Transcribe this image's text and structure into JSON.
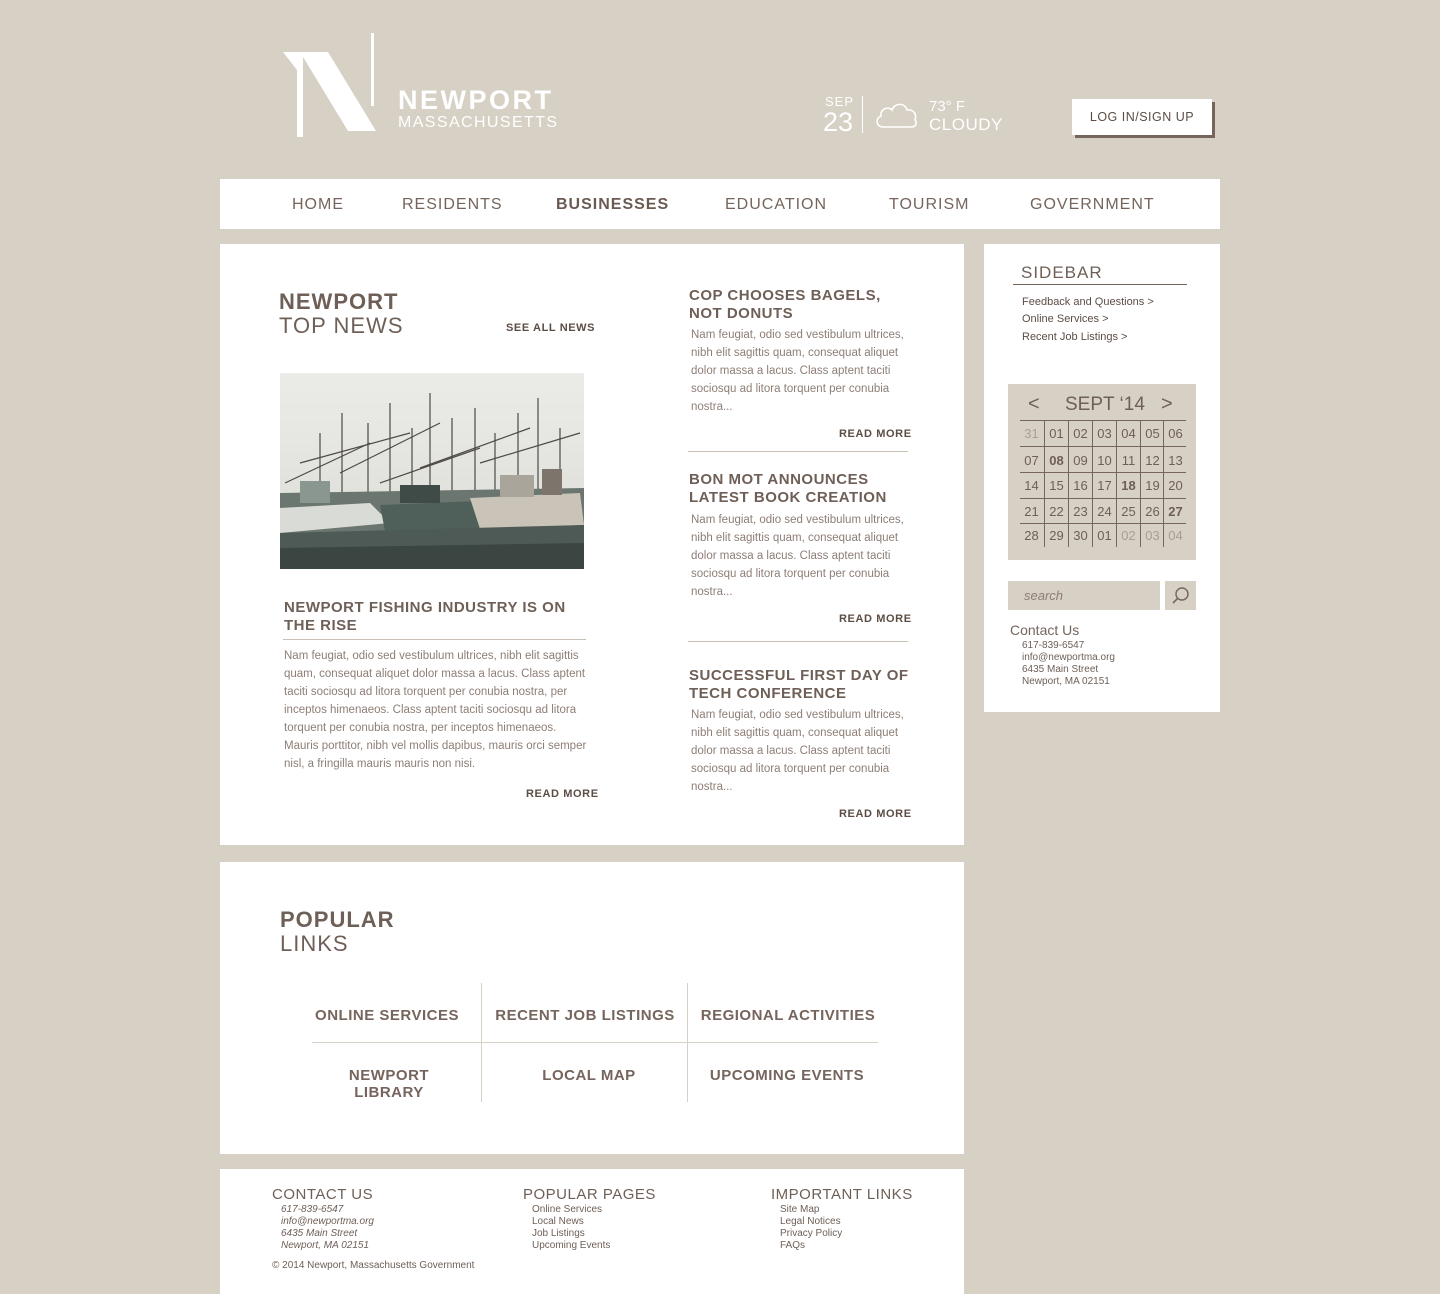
{
  "header": {
    "brand_name": "NEWPORT",
    "brand_sub": "MASSACHUSETTS",
    "weather": {
      "month": "SEP",
      "day": "23",
      "temp": "73° F",
      "condition": "CLOUDY",
      "icon": "cloud-icon"
    },
    "login_label": "LOG IN/SIGN UP"
  },
  "nav": {
    "items": [
      {
        "label": "HOME"
      },
      {
        "label": "RESIDENTS"
      },
      {
        "label": "BUSINESSES"
      },
      {
        "label": "EDUCATION"
      },
      {
        "label": "TOURISM"
      },
      {
        "label": "GOVERNMENT"
      }
    ],
    "active": "BUSINESSES"
  },
  "news": {
    "title_bold": "NEWPORT",
    "title_light": "TOP NEWS",
    "see_all": "SEE ALL NEWS",
    "featured": {
      "headline_line1": "NEWPORT FISHING INDUSTRY IS ON",
      "headline_line2": "THE RISE",
      "body_lines": [
        "Nam feugiat, odio sed vestibulum ultrices, nibh elit sagittis",
        "quam, consequat aliquet dolor massa a lacus. Class aptent",
        "taciti sociosqu ad litora torquent per conubia nostra, per",
        "inceptos himenaeos. Class aptent taciti sociosqu ad litora",
        "torquent per conubia nostra, per inceptos himenaeos.",
        "Mauris porttitor, nibh vel mollis dapibus, mauris orci semper",
        "nisl, a fringilla mauris mauris non nisi."
      ],
      "read_more": "READ MORE"
    },
    "stories": [
      {
        "headline_line1": "COP CHOOSES BAGELS,",
        "headline_line2": "NOT DONUTS",
        "body_lines": [
          "Nam feugiat, odio sed vestibulum ultrices,",
          "nibh elit sagittis quam, consequat aliquet",
          "dolor massa a lacus. Class aptent taciti",
          "sociosqu ad litora torquent per conubia",
          "nostra..."
        ],
        "read_more": "READ MORE"
      },
      {
        "headline_line1": "BON MOT ANNOUNCES",
        "headline_line2": "LATEST BOOK CREATION",
        "body_lines": [
          "Nam feugiat, odio sed vestibulum ultrices,",
          "nibh elit sagittis quam, consequat aliquet",
          "dolor massa a lacus. Class aptent taciti",
          "sociosqu ad litora torquent per conubia",
          "nostra..."
        ],
        "read_more": "READ MORE"
      },
      {
        "headline_line1": "SUCCESSFUL FIRST DAY OF",
        "headline_line2": "TECH CONFERENCE",
        "body_lines": [
          "Nam feugiat, odio sed vestibulum ultrices,",
          "nibh elit sagittis quam, consequat aliquet",
          "dolor massa a lacus. Class aptent taciti",
          "sociosqu ad litora torquent per conubia",
          "nostra..."
        ],
        "read_more": "READ MORE"
      }
    ]
  },
  "sidebar": {
    "title": "SIDEBAR",
    "links": [
      "Feedback and Questions >",
      "Online Services >",
      "Recent Job Listings >"
    ],
    "calendar": {
      "month_label": "SEPT ‘14",
      "prev": "<",
      "next": ">",
      "weeks": [
        [
          "31",
          "01",
          "02",
          "03",
          "04",
          "05",
          "06"
        ],
        [
          "07",
          "08",
          "09",
          "10",
          "11",
          "12",
          "13"
        ],
        [
          "14",
          "15",
          "16",
          "17",
          "18",
          "19",
          "20"
        ],
        [
          "21",
          "22",
          "23",
          "24",
          "25",
          "26",
          "27"
        ],
        [
          "28",
          "29",
          "30",
          "01",
          "02",
          "03",
          "04"
        ]
      ],
      "outside_month": [
        "0-0",
        "4-4",
        "4-5",
        "4-6"
      ],
      "highlighted": [
        "08",
        "18",
        "27"
      ]
    },
    "search_placeholder": "search",
    "contact": {
      "title": "Contact Us",
      "phone": "617-839-6547",
      "email": "info@newportma.org",
      "address1": "6435 Main Street",
      "address2": "Newport, MA 02151"
    }
  },
  "popular": {
    "title_bold": "POPULAR",
    "title_light": "LINKS",
    "links": [
      "ONLINE SERVICES",
      "RECENT JOB LISTINGS",
      "REGIONAL ACTIVITIES",
      "NEWPORT LIBRARY",
      "LOCAL MAP",
      "UPCOMING EVENTS"
    ]
  },
  "footer": {
    "contact": {
      "title": "CONTACT US",
      "items": [
        "617-839-6547",
        "info@newportma.org",
        "6435 Main Street",
        "Newport, MA 02151"
      ]
    },
    "pages": {
      "title": "POPULAR PAGES",
      "items": [
        "Online Services",
        "Local News",
        "Job Listings",
        "Upcoming Events"
      ]
    },
    "important": {
      "title": "IMPORTANT LINKS",
      "items": [
        "Site Map",
        "Legal Notices",
        "Privacy Policy",
        "FAQs"
      ]
    },
    "copyright": "© 2014 Newport, Massachusetts Government"
  },
  "colors": {
    "background": "#d7d0c4",
    "text": "#75655c",
    "panel": "#ffffff"
  }
}
